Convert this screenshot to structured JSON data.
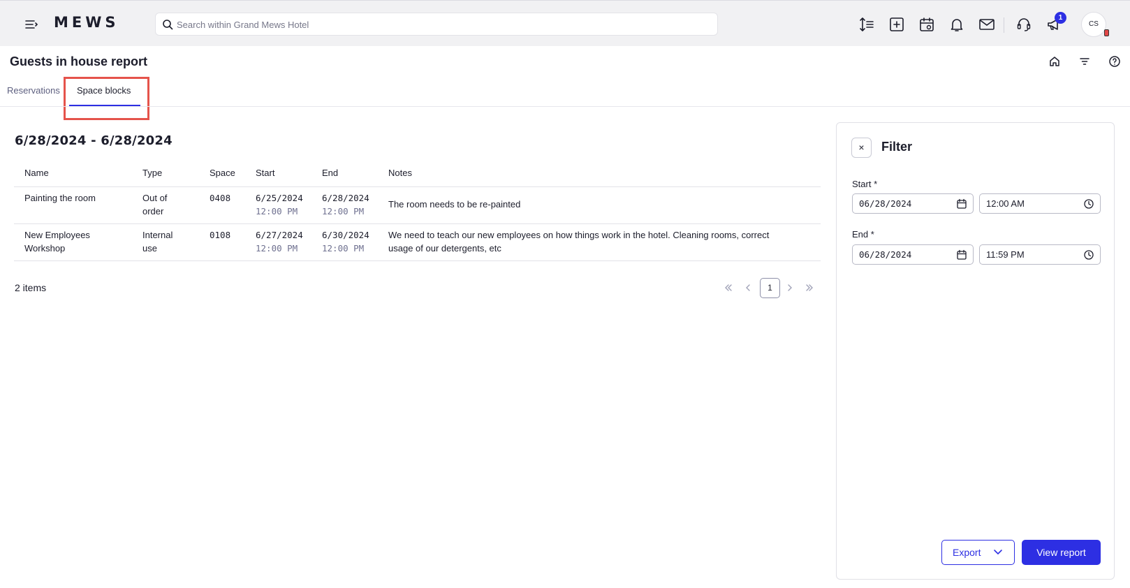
{
  "app": {
    "logo": "MEWS"
  },
  "search": {
    "placeholder": "Search within Grand Mews Hotel"
  },
  "notifications": {
    "badge_count": "1"
  },
  "user": {
    "initials": "CS"
  },
  "page": {
    "title": "Guests in house report",
    "tabs": [
      {
        "label": "Reservations",
        "active": false
      },
      {
        "label": "Space blocks",
        "active": true
      }
    ]
  },
  "report": {
    "date_range": "6/28/2024 - 6/28/2024",
    "columns": [
      "Name",
      "Type",
      "Space",
      "Start",
      "End",
      "Notes"
    ],
    "rows": [
      {
        "name": "Painting the room",
        "type_line1": "Out of",
        "type_line2": "order",
        "space": "0408",
        "start_date": "6/25/2024",
        "start_time": "12:00 PM",
        "end_date": "6/28/2024",
        "end_time": "12:00 PM",
        "notes": "The room needs to be re-painted"
      },
      {
        "name_line1": "New Employees",
        "name_line2": "Workshop",
        "type_line1": "Internal",
        "type_line2": "use",
        "space": "0108",
        "start_date": "6/27/2024",
        "start_time": "12:00 PM",
        "end_date": "6/30/2024",
        "end_time": "12:00 PM",
        "notes_line1": "We need to teach our new employees on how things work in the hotel. Cleaning rooms, correct",
        "notes_line2": "usage of our detergents, etc"
      }
    ],
    "items_count": "2 items",
    "pagination": {
      "current_page": "1"
    }
  },
  "filter": {
    "title": "Filter",
    "close_icon": "×",
    "start_label": "Start *",
    "start_date": "06/28/2024",
    "start_time": "12:00 AM",
    "end_label": "End *",
    "end_date": "06/28/2024",
    "end_time": "11:59 PM",
    "export_label": "Export",
    "view_report_label": "View report"
  },
  "colors": {
    "accent": "#2d2fe3",
    "topbar_bg": "#f1f1f3",
    "highlight": "#e5534b"
  }
}
